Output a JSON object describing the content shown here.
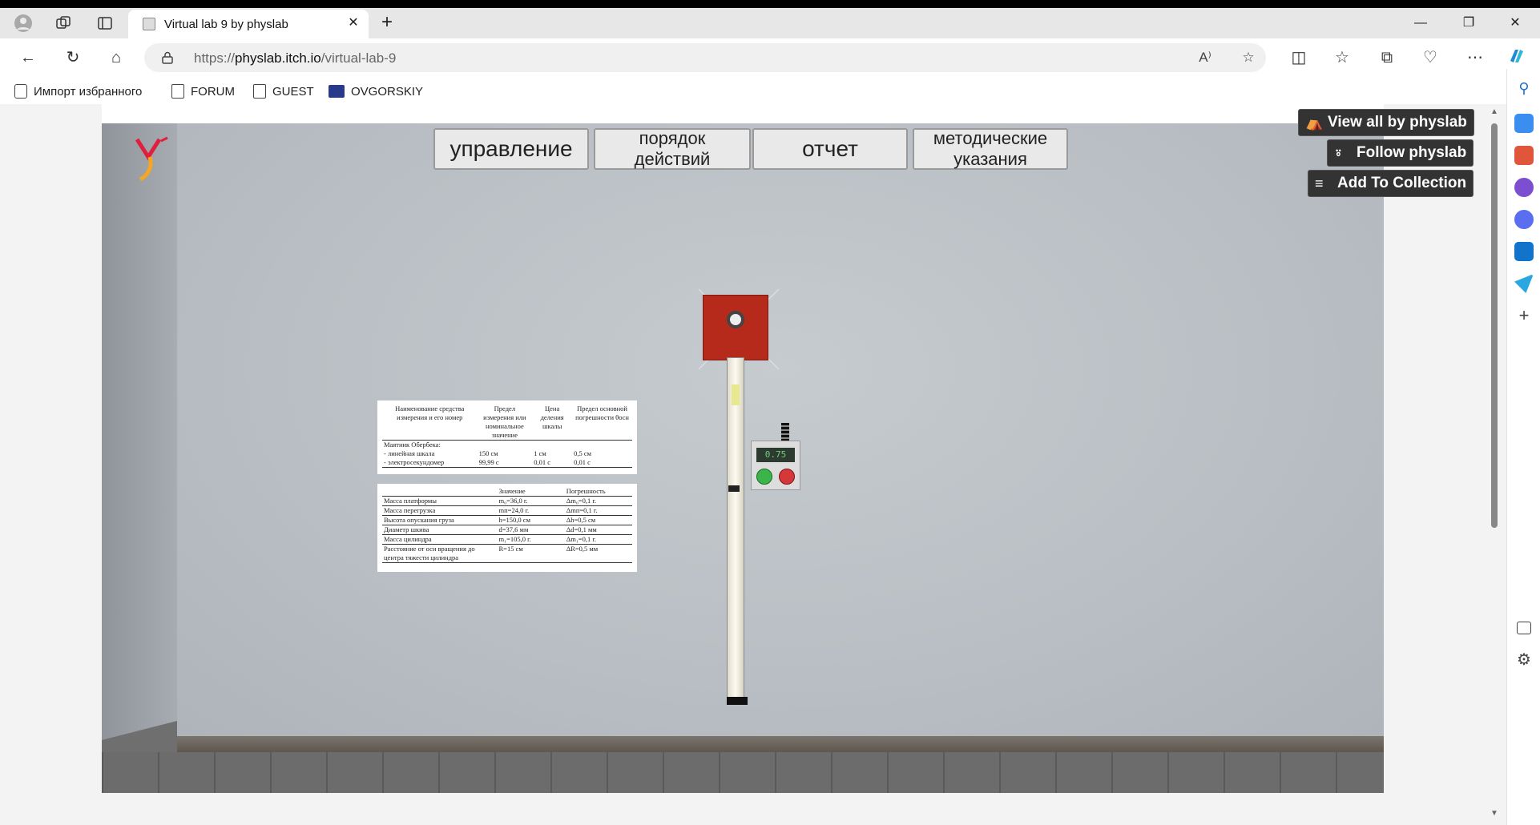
{
  "browser": {
    "tab_title": "Virtual lab 9 by physlab",
    "url_scheme": "https://",
    "url_host": "physlab.itch.io",
    "url_path": "/virtual-lab-9",
    "bookmarks": [
      {
        "label": "Импорт избранного",
        "icon": "folder-import-icon"
      },
      {
        "label": "FORUM",
        "icon": "page-icon"
      },
      {
        "label": "GUEST",
        "icon": "page-icon"
      },
      {
        "label": "OVGORSKIY",
        "icon": "site-favicon-icon"
      }
    ]
  },
  "itch": {
    "view_all": "View all by physlab",
    "follow": "Follow physlab",
    "add_collection": "Add To Collection"
  },
  "lab": {
    "menu": [
      "управление",
      "порядок действий",
      "отчет",
      "методические указания"
    ],
    "timer_display": "0.75",
    "instruments": {
      "headers": [
        "Наименование средства измерения и его номер",
        "Предел измерения или номинальное значение",
        "Цена деления шкалы",
        "Предел основной погрешности θосн"
      ],
      "group": "Маятник Обербека:",
      "rows": [
        [
          "- линейная шкала",
          "150 см",
          "1 см",
          "0,5 см"
        ],
        [
          "- электросекундомер",
          "99,99 с",
          "0,01 с",
          "0,01 с"
        ]
      ]
    },
    "params": {
      "headers": [
        "",
        "Значение",
        "Погрешность"
      ],
      "rows": [
        [
          "Масса платформы",
          "m₀=36,0 г.",
          "Δm₀=0,1 г."
        ],
        [
          "Масса перегрузка",
          "mп=24,0 г.",
          "Δmп=0,1 г."
        ],
        [
          "Высота опускания груза",
          "h=150,0 см",
          "Δh=0,5 см"
        ],
        [
          "Диаметр шкива",
          "d=37,6 мм",
          "Δd=0,1 мм"
        ],
        [
          "Масса цилиндра",
          "m₁=105,0 г.",
          "Δm₁=0,1 г."
        ],
        [
          "Расстояние от оси вращения до центра тяжести цилиндра",
          "R=15 см",
          "ΔR=0,5 мм"
        ]
      ]
    }
  },
  "colors": {
    "wall": "#b8bec3",
    "red_block": "#b62a1c",
    "itch_button": "#333333"
  }
}
